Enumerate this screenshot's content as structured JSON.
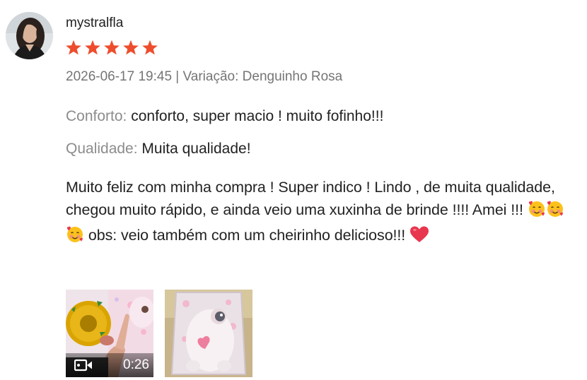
{
  "review": {
    "username": "mystralfla",
    "rating": 5,
    "rating_max": 5,
    "date": "2026-06-17 19:45",
    "separator": " | ",
    "variation_label": "Variação:",
    "variation_value": "Denguinho Rosa",
    "attributes": [
      {
        "label": "Conforto:",
        "value": "conforto, super macio ! muito fofinho!!!"
      },
      {
        "label": "Qualidade:",
        "value": "Muita qualidade!"
      }
    ],
    "body_part1": "Muito feliz com minha compra ! Super indico ! Lindo , de muita qualidade, chegou muito rápido, e ainda veio uma xuxinha de brinde !!!! Amei !!! ",
    "body_part2": " obs: veio também com um cheirinho delicioso!!! ",
    "emojis": [
      "smiling-face-with-hearts",
      "smiling-face-with-hearts",
      "smiling-face-with-hearts",
      "red-heart"
    ],
    "media": [
      {
        "type": "video",
        "duration": "0:26",
        "icon": "video-camera-icon"
      },
      {
        "type": "image"
      }
    ]
  },
  "colors": {
    "star": "#ee4d2d",
    "label_grey": "#8c8c8c",
    "meta_grey": "#757575",
    "text": "#222222"
  }
}
